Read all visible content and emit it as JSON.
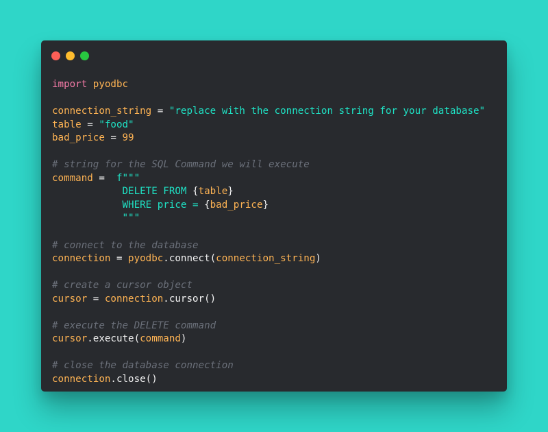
{
  "colors": {
    "background": "#2fd6c8",
    "window": "#282a2e",
    "dot_close": "#ff5f57",
    "dot_minimize": "#febc2e",
    "dot_maximize": "#28c840",
    "keyword": "#f27aa6",
    "variable": "#ffb454",
    "string": "#1fe2c5",
    "comment": "#6b707a",
    "plain": "#f2f2f2"
  },
  "window_controls": [
    "close-dot",
    "minimize-dot",
    "maximize-dot"
  ],
  "code_lines": [
    [
      {
        "t": "import",
        "c": "keyword"
      },
      {
        "t": " ",
        "c": "plain"
      },
      {
        "t": "pyodbc",
        "c": "variable"
      }
    ],
    [],
    [
      {
        "t": "connection_string",
        "c": "variable"
      },
      {
        "t": " = ",
        "c": "plain"
      },
      {
        "t": "\"replace with the connection string for your database\"",
        "c": "string"
      }
    ],
    [
      {
        "t": "table",
        "c": "variable"
      },
      {
        "t": " = ",
        "c": "plain"
      },
      {
        "t": "\"food\"",
        "c": "string"
      }
    ],
    [
      {
        "t": "bad_price",
        "c": "variable"
      },
      {
        "t": " = ",
        "c": "plain"
      },
      {
        "t": "99",
        "c": "variable"
      }
    ],
    [],
    [
      {
        "t": "# string for the SQL Command we will execute",
        "c": "comment"
      }
    ],
    [
      {
        "t": "command",
        "c": "variable"
      },
      {
        "t": " =  ",
        "c": "plain"
      },
      {
        "t": "f\"\"\"",
        "c": "string"
      }
    ],
    [
      {
        "t": "            DELETE FROM ",
        "c": "string"
      },
      {
        "t": "{",
        "c": "plain"
      },
      {
        "t": "table",
        "c": "variable"
      },
      {
        "t": "}",
        "c": "plain"
      }
    ],
    [
      {
        "t": "            WHERE price = ",
        "c": "string"
      },
      {
        "t": "{",
        "c": "plain"
      },
      {
        "t": "bad_price",
        "c": "variable"
      },
      {
        "t": "}",
        "c": "plain"
      }
    ],
    [
      {
        "t": "            \"\"\"",
        "c": "string"
      }
    ],
    [],
    [
      {
        "t": "# connect to the database",
        "c": "comment"
      }
    ],
    [
      {
        "t": "connection",
        "c": "variable"
      },
      {
        "t": " = ",
        "c": "plain"
      },
      {
        "t": "pyodbc",
        "c": "variable"
      },
      {
        "t": ".connect(",
        "c": "plain"
      },
      {
        "t": "connection_string",
        "c": "variable"
      },
      {
        "t": ")",
        "c": "plain"
      }
    ],
    [],
    [
      {
        "t": "# create a cursor object",
        "c": "comment"
      }
    ],
    [
      {
        "t": "cursor",
        "c": "variable"
      },
      {
        "t": " = ",
        "c": "plain"
      },
      {
        "t": "connection",
        "c": "variable"
      },
      {
        "t": ".cursor()",
        "c": "plain"
      }
    ],
    [],
    [
      {
        "t": "# execute the DELETE command",
        "c": "comment"
      }
    ],
    [
      {
        "t": "cursor",
        "c": "variable"
      },
      {
        "t": ".execute(",
        "c": "plain"
      },
      {
        "t": "command",
        "c": "variable"
      },
      {
        "t": ")",
        "c": "plain"
      }
    ],
    [],
    [
      {
        "t": "# close the database connection",
        "c": "comment"
      }
    ],
    [
      {
        "t": "connection",
        "c": "variable"
      },
      {
        "t": ".close()",
        "c": "plain"
      }
    ]
  ]
}
